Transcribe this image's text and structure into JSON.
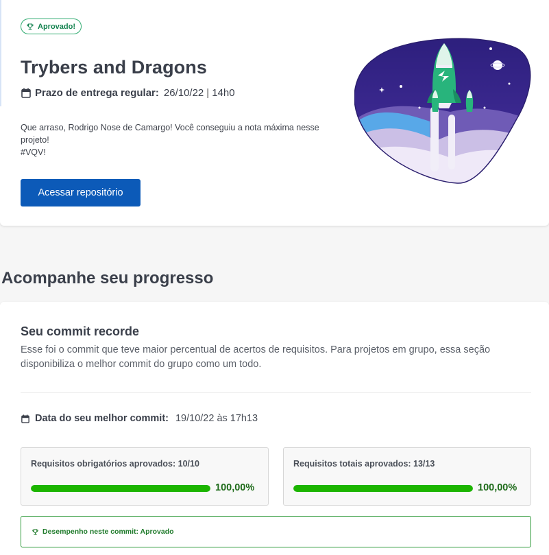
{
  "project": {
    "badge": "Aprovado!",
    "title": "Trybers and Dragons",
    "deadline_label": "Prazo de entrega regular:",
    "deadline_date": "26/10/22",
    "deadline_sep": "|",
    "deadline_time": "14h0",
    "message_line1": "Que arraso, Rodrigo Nose de Camargo! Você conseguiu a nota máxima nesse projeto!",
    "message_line2": "#VQV!",
    "repo_button": "Acessar repositório"
  },
  "progress": {
    "section_title": "Acompanhe seu progresso",
    "commit_title": "Seu commit recorde",
    "commit_desc": "Esse foi o commit que teve maior percentual de acertos de requisitos. Para projetos em grupo, essa seção disponibiliza o melhor commit do grupo como um todo.",
    "best_label": "Data do seu melhor commit:",
    "best_value": "19/10/22 às 17h13",
    "mandatory": {
      "label": "Requisitos obrigatórios aprovados: 10/10",
      "percent_text": "100,00%",
      "fraction": 1.0
    },
    "total": {
      "label": "Requisitos totais aprovados: 13/13",
      "percent_text": "100,00%",
      "fraction": 1.0
    },
    "performance": "Desempenho neste commit: Aprovado"
  },
  "colors": {
    "accent_blue": "#0c5ab8",
    "success_green": "#1cb500",
    "badge_green": "#13824f"
  },
  "icons": [
    "trophy-icon",
    "calendar-icon",
    "rocket-illustration"
  ]
}
